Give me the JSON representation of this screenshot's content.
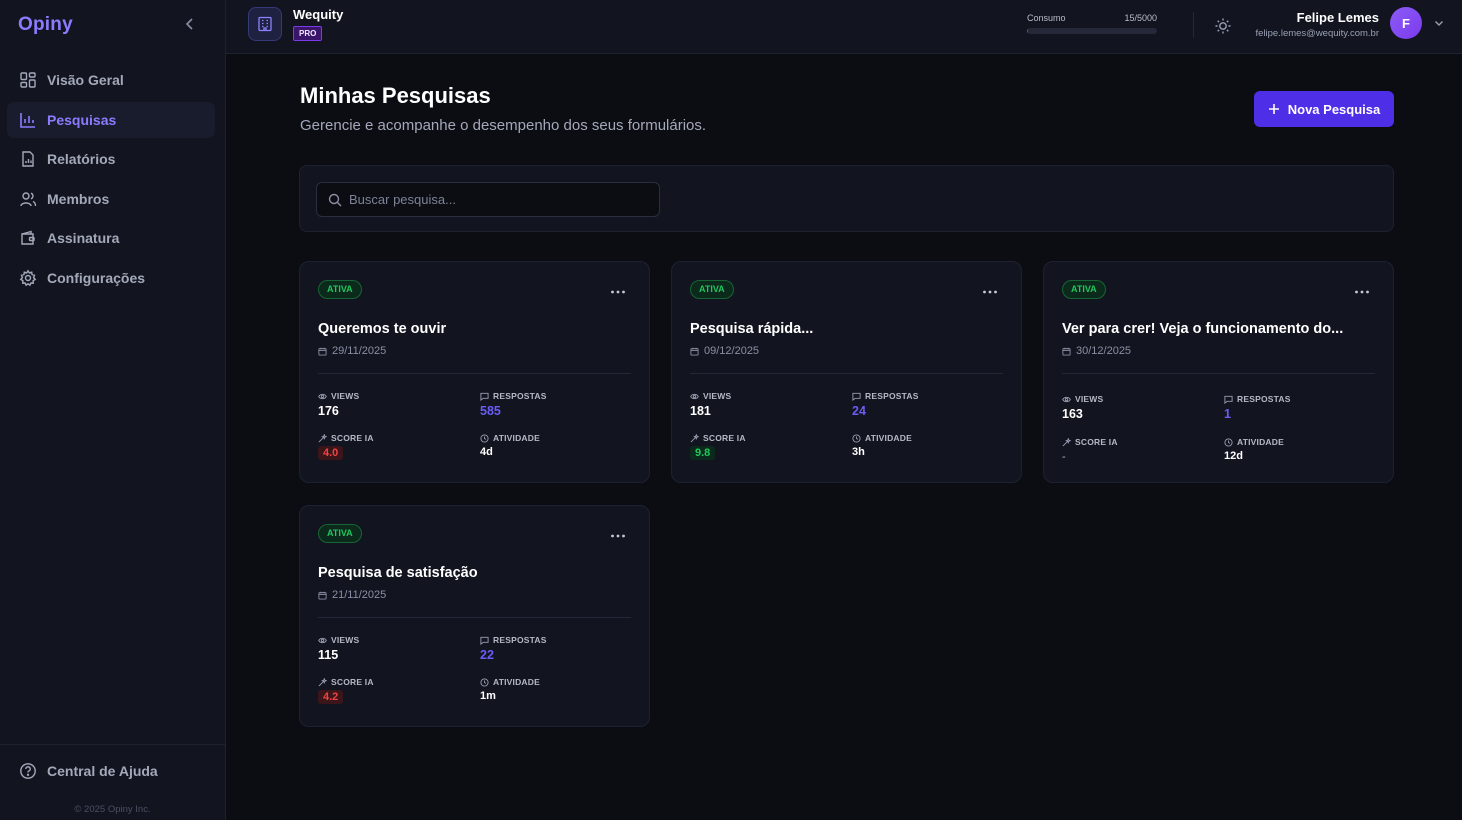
{
  "sidebar": {
    "brand": "Opiny",
    "items": [
      {
        "label": "Visão Geral"
      },
      {
        "label": "Pesquisas"
      },
      {
        "label": "Relatórios"
      },
      {
        "label": "Membros"
      },
      {
        "label": "Assinatura"
      },
      {
        "label": "Configurações"
      }
    ],
    "help_label": "Central de Ajuda",
    "copyright": "© 2025 Opiny Inc."
  },
  "header": {
    "org_name": "Wequity",
    "plan_badge": "PRO",
    "usage": {
      "label": "Consumo",
      "value_text": "15/5000",
      "fraction": 0.003
    },
    "user": {
      "name": "Felipe Lemes",
      "email": "felipe.lemes@wequity.com.br",
      "initial": "F"
    }
  },
  "main": {
    "title": "Minhas Pesquisas",
    "subtitle": "Gerencie e acompanhe o desempenho dos seus formulários.",
    "new_button_label": "Nova Pesquisa",
    "search": {
      "placeholder": "Buscar pesquisa...",
      "value": ""
    },
    "stat_labels": {
      "views": "VIEWS",
      "respostas": "RESPOSTAS",
      "score": "SCORE IA",
      "atividade": "ATIVIDADE"
    },
    "surveys": [
      {
        "status": "ATIVA",
        "title": "Queremos te ouvir",
        "date": "29/11/2025",
        "views": "176",
        "respostas": "585",
        "score": "4.0",
        "atividade": "4d"
      },
      {
        "status": "ATIVA",
        "title": "Pesquisa rápida...",
        "date": "09/12/2025",
        "views": "181",
        "respostas": "24",
        "score": "9.8",
        "atividade": "3h"
      },
      {
        "status": "ATIVA",
        "title": "Ver para crer! Veja o funcionamento do...",
        "date": "30/12/2025",
        "views": "163",
        "respostas": "1",
        "score": "-",
        "atividade": "12d"
      },
      {
        "status": "ATIVA",
        "title": "Pesquisa de satisfação",
        "date": "21/11/2025",
        "views": "115",
        "respostas": "22",
        "score": "4.2",
        "atividade": "1m"
      }
    ]
  },
  "colors": {
    "accent": "#4f2ee8",
    "brand": "#8b7cff",
    "status_active": "#22c55e",
    "score_bad": "#ef4444",
    "score_good": "#22c55e"
  }
}
